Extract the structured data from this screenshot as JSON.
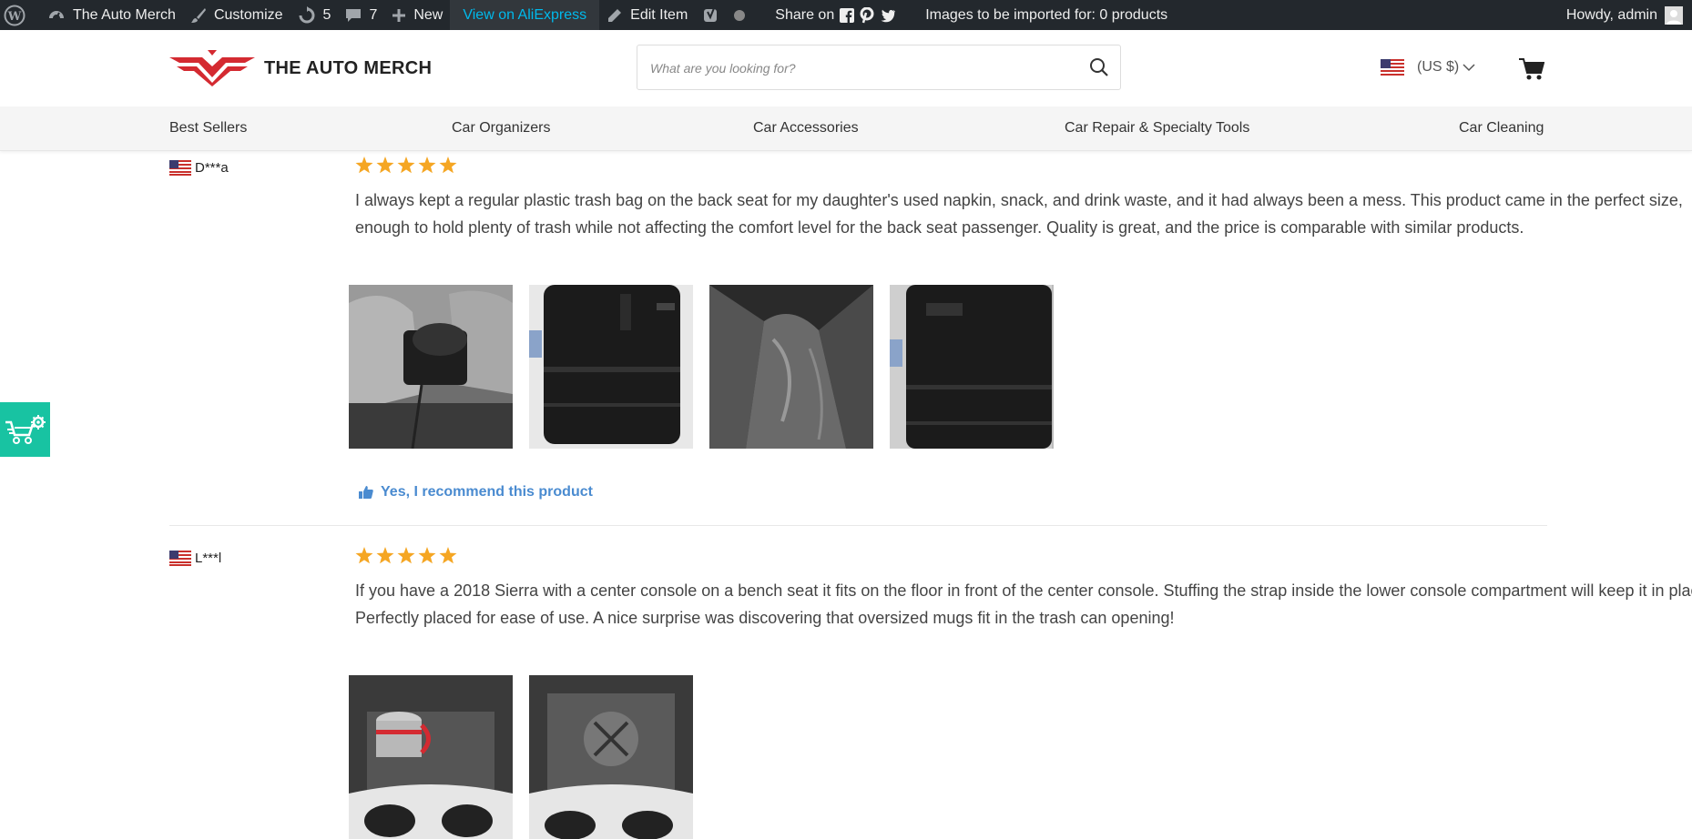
{
  "adminbar": {
    "site_name": "The Auto Merch",
    "customize": "Customize",
    "updates_count": "5",
    "comments_count": "7",
    "new": "New",
    "view_aliexpress": "View on AliExpress",
    "edit_item": "Edit Item",
    "share_on": "Share on",
    "import_status": "Images to be imported for: 0 products",
    "greeting": "Howdy, admin"
  },
  "header": {
    "logo_text": "THE AUTO MERCH",
    "search_placeholder": "What are you looking for?",
    "currency": "(US $)"
  },
  "nav": {
    "items": [
      "Best Sellers",
      "Car Organizers",
      "Car Accessories",
      "Car Repair & Specialty Tools",
      "Car Cleaning"
    ]
  },
  "reviews": [
    {
      "user": "D***a",
      "rating": 5,
      "text": "I always kept a regular plastic trash bag on the back seat for my daughter's used napkin, snack, and drink waste, and it had always been a mess. This product came in the perfect size, enough to hold plenty of trash while not affecting the comfort level for the back seat passenger. Quality is great, and the price is comparable with similar products.",
      "recommend": "Yes, I recommend this product"
    },
    {
      "user": "L***l",
      "rating": 5,
      "text": "If you have a 2018 Sierra with a center console on a bench seat it fits on the floor in front of the center console. Stuffing the strap inside the lower console compartment will keep it in place! Perfectly placed for ease of use. A nice surprise was discovering that oversized mugs fit in the trash can opening!"
    }
  ],
  "colors": {
    "adminbar_bg": "#23282d",
    "accent_link": "#00b9eb",
    "star": "#f5a623",
    "recommend": "#4a8bd0",
    "widget": "#18c3a2",
    "logo_red": "#d42a31"
  }
}
